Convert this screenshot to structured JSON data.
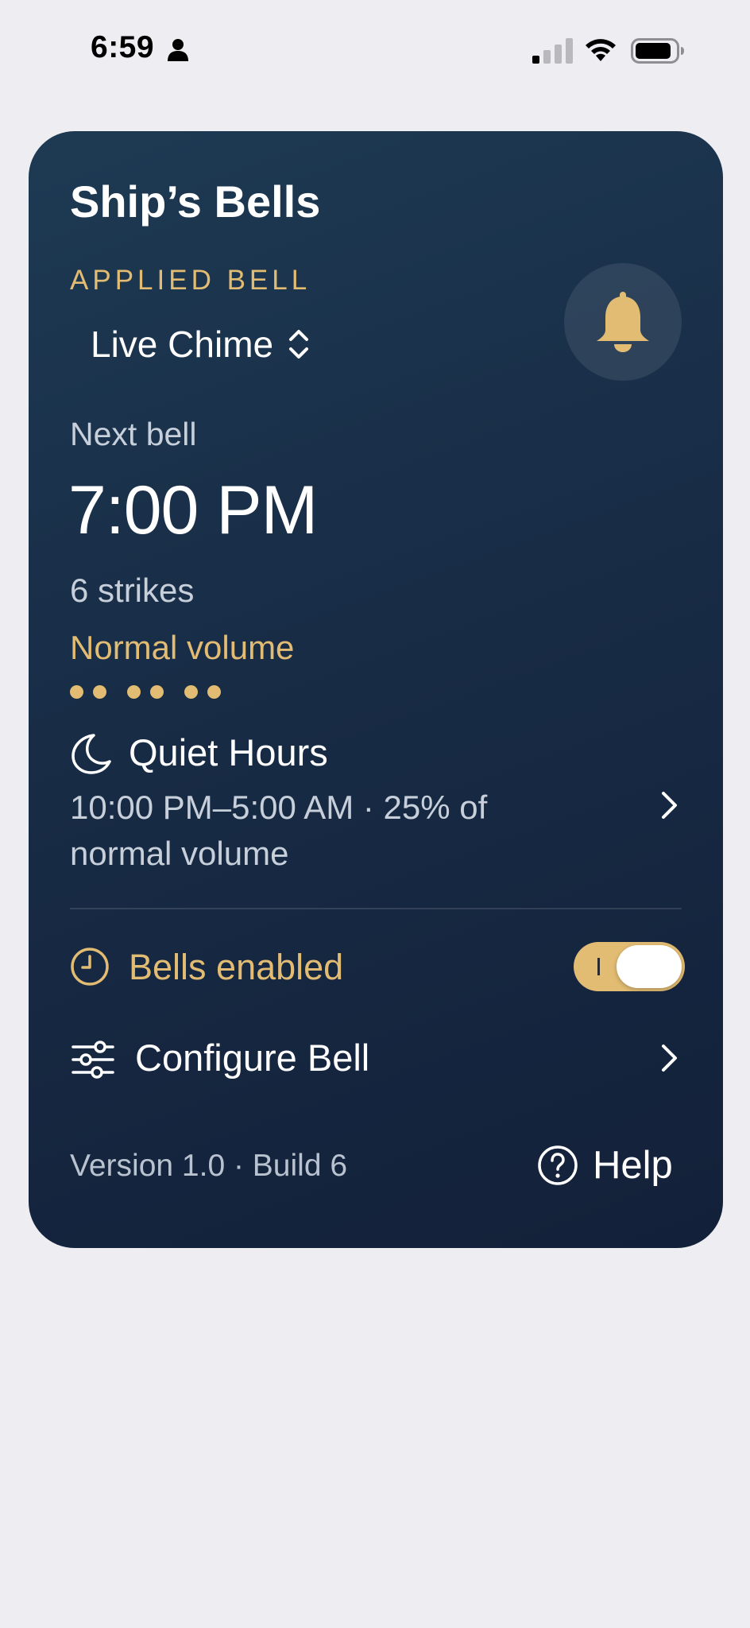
{
  "status_bar": {
    "time": "6:59",
    "icons": [
      "person-icon",
      "cellular-signal-icon",
      "wifi-icon",
      "battery-icon"
    ]
  },
  "card": {
    "title": "Ship’s Bells",
    "applied_bell": {
      "label": "APPLIED BELL",
      "selected": "Live Chime"
    },
    "next_bell": {
      "label": "Next bell",
      "time": "7:00 PM",
      "strikes": "6 strikes",
      "volume": "Normal volume",
      "strike_pattern": [
        2,
        2,
        2
      ]
    },
    "quiet_hours": {
      "title": "Quiet Hours",
      "description": "10:00 PM–5:00 AM · 25% of normal volume"
    },
    "bells_enabled": {
      "label": "Bells enabled",
      "on": true
    },
    "configure": {
      "label": "Configure Bell"
    },
    "footer": {
      "version": "Version 1.0 · Build 6",
      "help_label": "Help"
    }
  },
  "colors": {
    "accent": "#E2BC73",
    "card_top": "#1E3A53",
    "card_bottom": "#132039",
    "background": "#EDEDF2"
  }
}
